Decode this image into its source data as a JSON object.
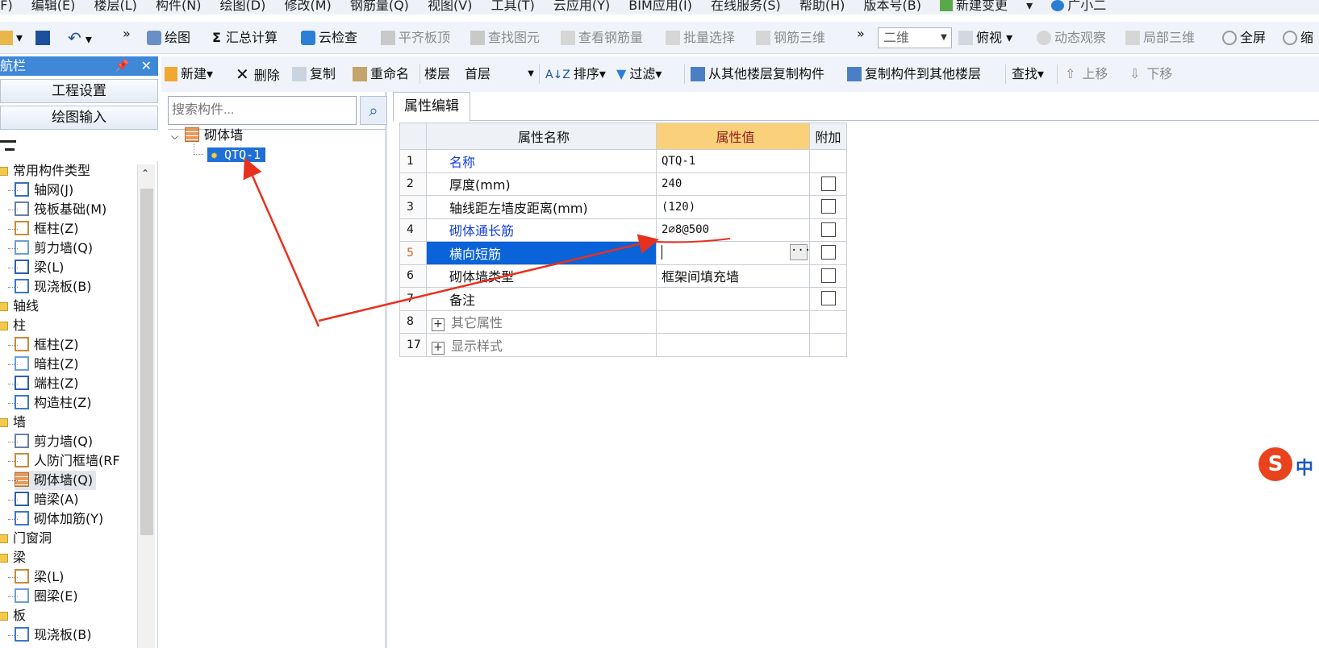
{
  "menubar": {
    "items": [
      "(F)",
      "编辑(E)",
      "楼层(L)",
      "构件(N)",
      "绘图(D)",
      "修改(M)",
      "钢筋量(Q)",
      "视图(V)",
      "工具(T)",
      "云应用(Y)",
      "BIM应用(I)",
      "在线服务(S)",
      "帮助(H)",
      "版本号(B)"
    ],
    "new_change": "新建变更",
    "user": "广小二"
  },
  "toolbar1": {
    "draw": "绘图",
    "sum": "汇总计算",
    "cloud_check": "云检查",
    "align_top": "平齐板顶",
    "find_elem": "查找图元",
    "view_rebar": "查看钢筋量",
    "batch_select": "批量选择",
    "rebar_3d": "钢筋三维",
    "view_mode": "二维",
    "top_view": "俯视",
    "dynamic": "动态观察",
    "local_3d": "局部三维",
    "fullscreen": "全屏",
    "zoom": "缩"
  },
  "nav": {
    "title": "导航栏",
    "project_settings": "工程设置",
    "draw_input": "绘图输入",
    "tree": [
      {
        "type": "folder",
        "label": "常用构件类型"
      },
      {
        "type": "item",
        "label": "轴网(J)"
      },
      {
        "type": "item",
        "label": "筏板基础(M)"
      },
      {
        "type": "item",
        "label": "框柱(Z)"
      },
      {
        "type": "item",
        "label": "剪力墙(Q)"
      },
      {
        "type": "item",
        "label": "梁(L)"
      },
      {
        "type": "item",
        "label": "现浇板(B)"
      },
      {
        "type": "folder",
        "label": "轴线"
      },
      {
        "type": "folder",
        "label": "柱"
      },
      {
        "type": "item",
        "label": "框柱(Z)"
      },
      {
        "type": "item",
        "label": "暗柱(Z)"
      },
      {
        "type": "item",
        "label": "端柱(Z)"
      },
      {
        "type": "item",
        "label": "构造柱(Z)"
      },
      {
        "type": "folder",
        "label": "墙"
      },
      {
        "type": "item",
        "label": "剪力墙(Q)"
      },
      {
        "type": "item",
        "label": "人防门框墙(RF"
      },
      {
        "type": "item",
        "label": "砌体墙(Q)"
      },
      {
        "type": "item",
        "label": "暗梁(A)"
      },
      {
        "type": "item",
        "label": "砌体加筋(Y)"
      },
      {
        "type": "folder",
        "label": "门窗洞"
      },
      {
        "type": "folder",
        "label": "梁"
      },
      {
        "type": "item",
        "label": "梁(L)"
      },
      {
        "type": "item",
        "label": "圈梁(E)"
      },
      {
        "type": "folder",
        "label": "板"
      },
      {
        "type": "item",
        "label": "现浇板(B)"
      }
    ]
  },
  "toolbar2": {
    "new": "新建",
    "delete": "删除",
    "copy": "复制",
    "rename": "重命名",
    "floor_label": "楼层",
    "floor_value": "首层",
    "sort": "排序",
    "filter": "过滤",
    "copy_from_floor": "从其他楼层复制构件",
    "copy_to_floor": "复制构件到其他楼层",
    "find": "查找",
    "move_up": "上移",
    "move_down": "下移"
  },
  "components": {
    "search_placeholder": "搜索构件...",
    "root": "砌体墙",
    "selected": "QTQ-1"
  },
  "property_editor": {
    "tab": "属性编辑",
    "headers": {
      "name": "属性名称",
      "value": "属性值",
      "extra": "附加"
    },
    "rows": [
      {
        "num": "1",
        "name": "名称",
        "value": "QTQ-1"
      },
      {
        "num": "2",
        "name": "厚度(mm)",
        "value": "240"
      },
      {
        "num": "3",
        "name": "轴线距左墙皮距离(mm)",
        "value": "(120)"
      },
      {
        "num": "4",
        "name": "砌体通长筋",
        "value": "2⌀8@500"
      },
      {
        "num": "5",
        "name": "横向短筋",
        "value": ""
      },
      {
        "num": "6",
        "name": "砌体墙类型",
        "value": "框架间填充墙"
      },
      {
        "num": "7",
        "name": "备注",
        "value": ""
      },
      {
        "num": "8",
        "name": "其它属性",
        "value": ""
      },
      {
        "num": "17",
        "name": "显示样式",
        "value": ""
      }
    ]
  },
  "ime": {
    "label": "中"
  },
  "colors": {
    "accent": "#1f6fd6",
    "header_highlight": "#fbd07a",
    "annotation_red": "#e8301e",
    "blue_text": "#1440d8"
  }
}
